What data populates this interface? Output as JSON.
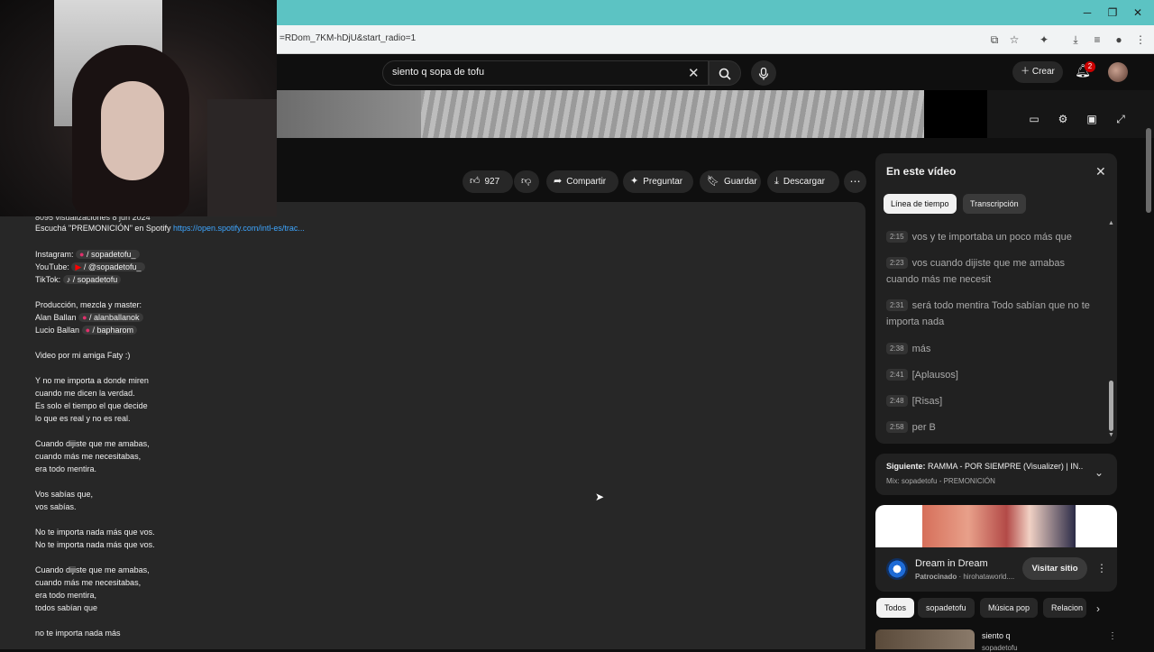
{
  "browser": {
    "url_fragment": "=RDom_7KM-hDjU&start_radio=1"
  },
  "header": {
    "search_value": "siento q sopa de tofu",
    "create_label": "Crear",
    "notification_count": "2"
  },
  "actions": {
    "likes": "927",
    "share": "Compartir",
    "ask": "Preguntar",
    "save": "Guardar",
    "download": "Descargar"
  },
  "description": {
    "views_line": "8095 visualizaciones  8 jun 2024",
    "spotify_prefix": "Escuchá \"PREMONICIÓN\" en Spotify",
    "spotify_link": "https://open.spotify.com/intl-es/trac...",
    "instagram_label": "Instagram:",
    "instagram_handle": "/ sopadetofu_",
    "youtube_label": "YouTube:",
    "youtube_handle": "/ @sopadetofu_",
    "tiktok_label": "TikTok:",
    "tiktok_handle": "/ sopadetofu",
    "production": "Producción, mezcla y master:",
    "alan_name": "Alan Ballan",
    "alan_handle": "/ alanballanok",
    "lucio_name": "Lucio Ballan",
    "lucio_handle": "/ bapharom",
    "video_by": "Video por mi amiga Faty :)",
    "lyrics": [
      "Y no me importa a donde miren",
      "cuando me dicen la verdad.",
      "Es solo el tiempo el que decide",
      "lo que es real y no es real.",
      "Cuando dijiste que me amabas,",
      "cuando más me necesitabas,",
      "era todo mentira.",
      "Vos sabías que,",
      "vos sabías.",
      "No te importa nada más que vos.",
      "No te importa nada más que vos.",
      "Cuando dijiste que me amabas,",
      "cuando más me necesitabas,",
      "era todo mentira,",
      "todos sabían que",
      "no te importa nada más"
    ]
  },
  "panel": {
    "title": "En este vídeo",
    "tabs": [
      "Línea de tiempo",
      "Transcripción"
    ],
    "transcript": [
      {
        "time": "2:15",
        "text": "vos y te importaba un poco más que"
      },
      {
        "time": "2:23",
        "text": "vos cuando dijiste que me amabas cuando más me necesit"
      },
      {
        "time": "2:31",
        "text": "será todo mentira Todo sabían que no te importa nada"
      },
      {
        "time": "2:38",
        "text": "más"
      },
      {
        "time": "2:41",
        "text": "[Aplausos]"
      },
      {
        "time": "2:48",
        "text": "[Risas]"
      },
      {
        "time": "2:58",
        "text": "per B"
      }
    ]
  },
  "next": {
    "label": "Siguiente:",
    "title": "RAMMA - POR SIEMPRE (Visualizer) | IN...",
    "mix": "Mix: sopadetofu - PREMONICIÓN"
  },
  "ad": {
    "title": "Dream in Dream",
    "sponsored": "Patrocinado",
    "domain": "· hirohataworld....",
    "button": "Visitar sitio"
  },
  "chips": [
    "Todos",
    "sopadetofu",
    "Música pop",
    "Relacion"
  ],
  "rec": {
    "title": "siento q",
    "channel": "sopadetofu"
  },
  "colors": {
    "accent_teal": "#5cc3c3",
    "bg": "#0f0f0f",
    "link": "#3ea6ff",
    "badge": "#cc0000"
  }
}
